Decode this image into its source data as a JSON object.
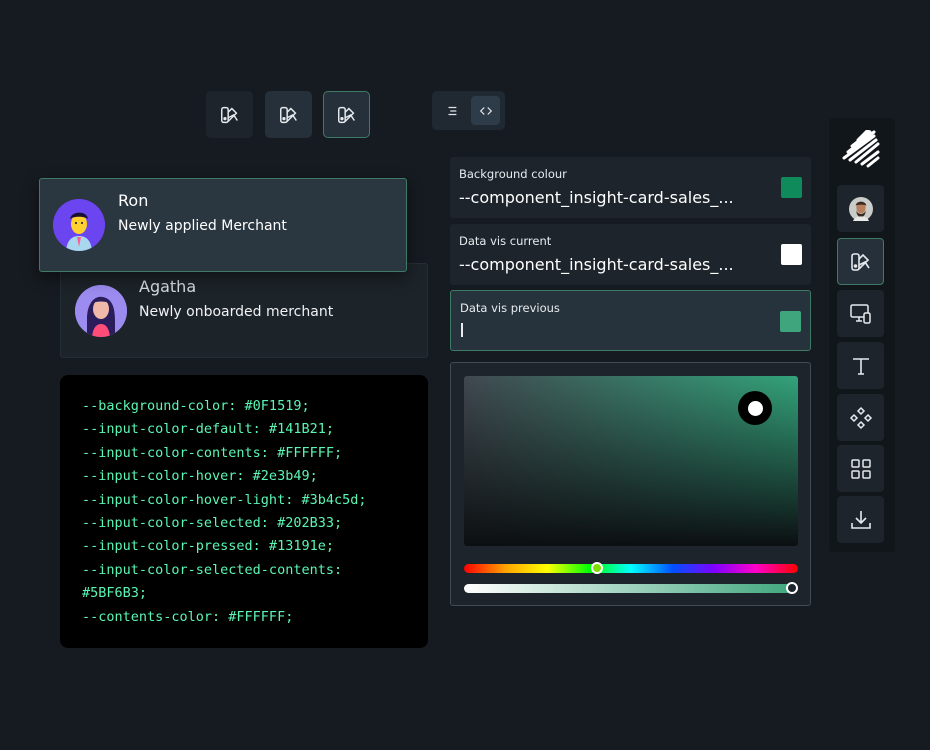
{
  "toolbar": {
    "icons": [
      "palette-icon",
      "palette-icon",
      "palette-icon"
    ]
  },
  "view_toggle": {
    "list_symbol": "☰",
    "code_symbol": "<>"
  },
  "cards": [
    {
      "name": "Ron",
      "subtitle": "Newly applied Merchant"
    },
    {
      "name": "Agatha",
      "subtitle": "Newly onboarded merchant"
    }
  ],
  "code": {
    "lines": [
      "--background-color: #0F1519;",
      "--input-color-default: #141B21;",
      "--input-color-contents: #FFFFFF;",
      "--input-color-hover: #2e3b49;",
      "--input-color-hover-light: #3b4c5d;",
      "--input-color-selected: #202B33;",
      "--input-color-pressed: #13191e;",
      "--input-color-selected-contents:",
      "#5BF6B3;",
      "--contents-color: #FFFFFF;"
    ],
    "color": "#5BF6B3"
  },
  "fields": [
    {
      "label": "Background colour",
      "value": "--component_insight-card-sales_...",
      "swatch": "#0f8a5a"
    },
    {
      "label": "Data vis current",
      "value": "--component_insight-card-sales_...",
      "swatch": "#ffffff"
    },
    {
      "label": "Data vis previous",
      "value": "",
      "swatch": "#3ea57c"
    }
  ],
  "picker": {
    "hue_position": 0.4,
    "alpha_position": 1.0
  },
  "rail": {
    "items": [
      "logo-icon",
      "avatar",
      "palette-icon",
      "devices-icon",
      "text-icon",
      "components-icon",
      "grid-icon",
      "download-icon"
    ]
  },
  "colors": {
    "background": "#161b21",
    "accent": "#3f7a66",
    "code_text": "#5bf6b3"
  }
}
